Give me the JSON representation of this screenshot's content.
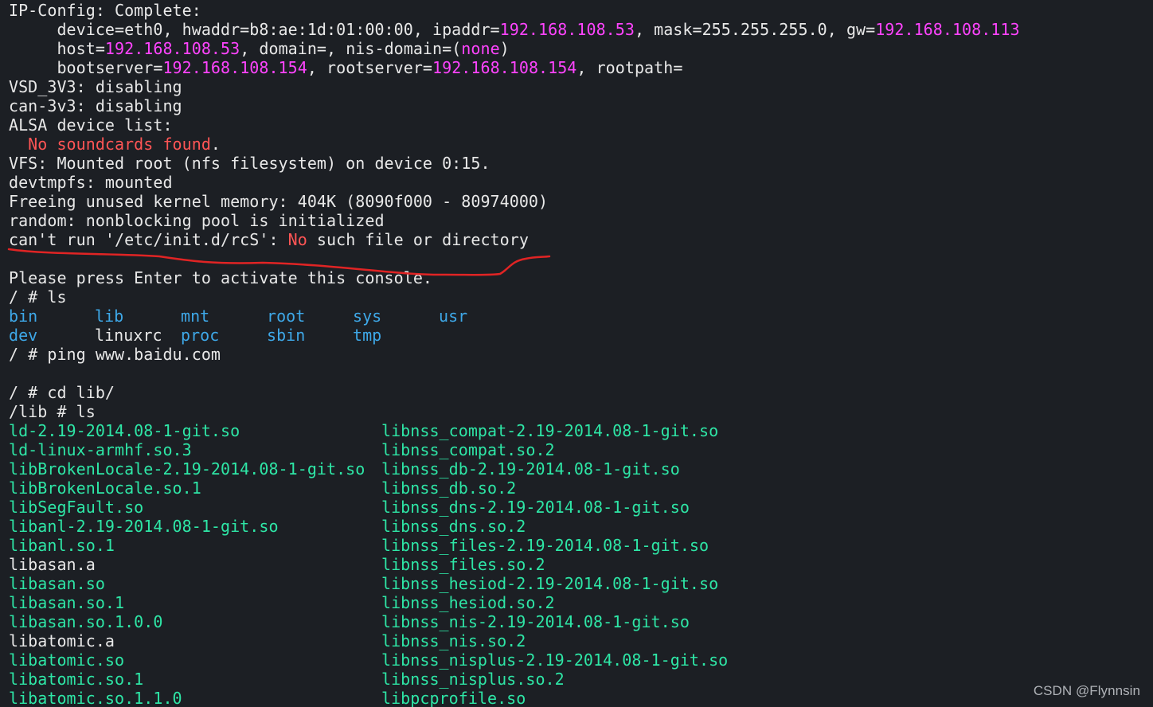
{
  "colors": {
    "background": "#1c1f24",
    "default_text": "#e8e8e8",
    "ip_magenta": "#ff44ff",
    "error_red": "#ff5555",
    "dir_blue": "#3ea8e8",
    "file_green": "#2ee6a6",
    "annotation_red": "#e02424"
  },
  "watermark": "CSDN @Flynnsin",
  "lines": [
    [
      {
        "t": "IP-Config: Complete:",
        "c": "default_text"
      }
    ],
    [
      {
        "t": "     device=eth0, hwaddr=b8:ae:1d:01:00:00, ipaddr=",
        "c": "default_text"
      },
      {
        "t": "192.168.108.53",
        "c": "ip_magenta"
      },
      {
        "t": ", mask=255.255.255.0, gw=",
        "c": "default_text"
      },
      {
        "t": "192.168.108.113",
        "c": "ip_magenta"
      }
    ],
    [
      {
        "t": "     host=",
        "c": "default_text"
      },
      {
        "t": "192.168.108.53",
        "c": "ip_magenta"
      },
      {
        "t": ", domain=, nis-domain=(",
        "c": "default_text"
      },
      {
        "t": "none",
        "c": "ip_magenta"
      },
      {
        "t": ")",
        "c": "default_text"
      }
    ],
    [
      {
        "t": "     bootserver=",
        "c": "default_text"
      },
      {
        "t": "192.168.108.154",
        "c": "ip_magenta"
      },
      {
        "t": ", rootserver=",
        "c": "default_text"
      },
      {
        "t": "192.168.108.154",
        "c": "ip_magenta"
      },
      {
        "t": ", rootpath=",
        "c": "default_text"
      }
    ],
    [
      {
        "t": "VSD_3V3: disabling",
        "c": "default_text"
      }
    ],
    [
      {
        "t": "can-3v3: disabling",
        "c": "default_text"
      }
    ],
    [
      {
        "t": "ALSA device list:",
        "c": "default_text"
      }
    ],
    [
      {
        "t": "  No soundcards found",
        "c": "error_red"
      },
      {
        "t": ".",
        "c": "default_text"
      }
    ],
    [
      {
        "t": "VFS: Mounted root (nfs filesystem) on device 0:15.",
        "c": "default_text"
      }
    ],
    [
      {
        "t": "devtmpfs: mounted",
        "c": "default_text"
      }
    ],
    [
      {
        "t": "Freeing unused kernel memory: 404K (8090f000 - 80974000)",
        "c": "default_text"
      }
    ],
    [
      {
        "t": "random: nonblocking pool is initialized",
        "c": "default_text"
      }
    ],
    [
      {
        "t": "can't run '/etc/init.d/rcS': ",
        "c": "default_text"
      },
      {
        "t": "No",
        "c": "error_red"
      },
      {
        "t": " such file or directory",
        "c": "default_text"
      }
    ],
    [],
    [
      {
        "t": "Please press Enter to activate this console.",
        "c": "default_text"
      }
    ],
    [
      {
        "t": "/ # ls",
        "c": "default_text"
      }
    ],
    {
      "cols": [
        [
          {
            "t": "bin",
            "c": "dir_blue"
          }
        ],
        [
          {
            "t": "lib",
            "c": "dir_blue"
          }
        ],
        [
          {
            "t": "mnt",
            "c": "dir_blue"
          }
        ],
        [
          {
            "t": "root",
            "c": "dir_blue"
          }
        ],
        [
          {
            "t": "sys",
            "c": "dir_blue"
          }
        ],
        [
          {
            "t": "usr",
            "c": "dir_blue"
          }
        ]
      ]
    },
    {
      "cols": [
        [
          {
            "t": "dev",
            "c": "dir_blue"
          }
        ],
        [
          {
            "t": "linuxrc",
            "c": "default_text"
          }
        ],
        [
          {
            "t": "proc",
            "c": "dir_blue"
          }
        ],
        [
          {
            "t": "sbin",
            "c": "dir_blue"
          }
        ],
        [
          {
            "t": "tmp",
            "c": "dir_blue"
          }
        ]
      ]
    },
    [
      {
        "t": "/ # ping www.baidu.com",
        "c": "default_text"
      }
    ],
    [],
    [
      {
        "t": "/ # cd lib/",
        "c": "default_text"
      }
    ],
    [
      {
        "t": "/lib # ls",
        "c": "default_text"
      }
    ],
    {
      "split": [
        [
          {
            "t": "ld-2.19-2014.08-1-git.so",
            "c": "file_green"
          }
        ],
        [
          {
            "t": "libnss_compat-2.19-2014.08-1-git.so",
            "c": "file_green"
          }
        ]
      ]
    },
    {
      "split": [
        [
          {
            "t": "ld-linux-armhf.so.3",
            "c": "file_green"
          }
        ],
        [
          {
            "t": "libnss_compat.so.2",
            "c": "file_green"
          }
        ]
      ]
    },
    {
      "split": [
        [
          {
            "t": "libBrokenLocale-2.19-2014.08-1-git.so",
            "c": "file_green"
          }
        ],
        [
          {
            "t": "libnss_db-2.19-2014.08-1-git.so",
            "c": "file_green"
          }
        ]
      ]
    },
    {
      "split": [
        [
          {
            "t": "libBrokenLocale.so.1",
            "c": "file_green"
          }
        ],
        [
          {
            "t": "libnss_db.so.2",
            "c": "file_green"
          }
        ]
      ]
    },
    {
      "split": [
        [
          {
            "t": "libSegFault.so",
            "c": "file_green"
          }
        ],
        [
          {
            "t": "libnss_dns-2.19-2014.08-1-git.so",
            "c": "file_green"
          }
        ]
      ]
    },
    {
      "split": [
        [
          {
            "t": "libanl-2.19-2014.08-1-git.so",
            "c": "file_green"
          }
        ],
        [
          {
            "t": "libnss_dns.so.2",
            "c": "file_green"
          }
        ]
      ]
    },
    {
      "split": [
        [
          {
            "t": "libanl.so.1",
            "c": "file_green"
          }
        ],
        [
          {
            "t": "libnss_files-2.19-2014.08-1-git.so",
            "c": "file_green"
          }
        ]
      ]
    },
    {
      "split": [
        [
          {
            "t": "libasan.a",
            "c": "default_text"
          }
        ],
        [
          {
            "t": "libnss_files.so.2",
            "c": "file_green"
          }
        ]
      ]
    },
    {
      "split": [
        [
          {
            "t": "libasan.so",
            "c": "file_green"
          }
        ],
        [
          {
            "t": "libnss_hesiod-2.19-2014.08-1-git.so",
            "c": "file_green"
          }
        ]
      ]
    },
    {
      "split": [
        [
          {
            "t": "libasan.so.1",
            "c": "file_green"
          }
        ],
        [
          {
            "t": "libnss_hesiod.so.2",
            "c": "file_green"
          }
        ]
      ]
    },
    {
      "split": [
        [
          {
            "t": "libasan.so.1.0.0",
            "c": "file_green"
          }
        ],
        [
          {
            "t": "libnss_nis-2.19-2014.08-1-git.so",
            "c": "file_green"
          }
        ]
      ]
    },
    {
      "split": [
        [
          {
            "t": "libatomic.a",
            "c": "default_text"
          }
        ],
        [
          {
            "t": "libnss_nis.so.2",
            "c": "file_green"
          }
        ]
      ]
    },
    {
      "split": [
        [
          {
            "t": "libatomic.so",
            "c": "file_green"
          }
        ],
        [
          {
            "t": "libnss_nisplus-2.19-2014.08-1-git.so",
            "c": "file_green"
          }
        ]
      ]
    },
    {
      "split": [
        [
          {
            "t": "libatomic.so.1",
            "c": "file_green"
          }
        ],
        [
          {
            "t": "libnss_nisplus.so.2",
            "c": "file_green"
          }
        ]
      ]
    },
    {
      "split": [
        [
          {
            "t": "libatomic.so.1.1.0",
            "c": "file_green"
          }
        ],
        [
          {
            "t": "libpcprofile.so",
            "c": "file_green"
          }
        ]
      ]
    }
  ]
}
